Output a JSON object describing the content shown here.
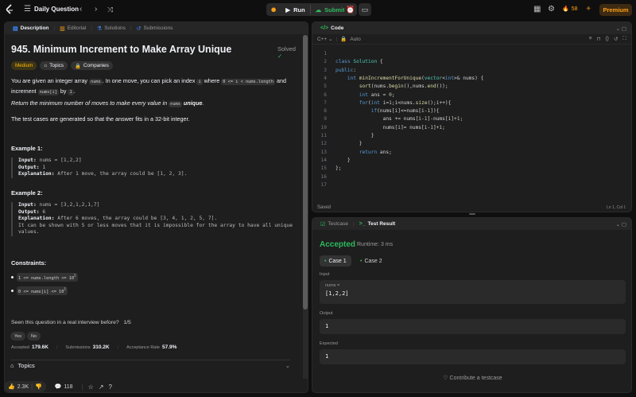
{
  "topbar": {
    "title": "Daily Question",
    "run_label": "Run",
    "submit_label": "Submit",
    "streak_count": "58",
    "premium_label": "Premium"
  },
  "description_panel": {
    "tabs": [
      {
        "label": "Description",
        "icon": "doc-icon"
      },
      {
        "label": "Editorial",
        "icon": "book-icon"
      },
      {
        "label": "Solutions",
        "icon": "flask-icon"
      },
      {
        "label": "Submissions",
        "icon": "history-icon"
      }
    ],
    "title": "945. Minimum Increment to Make Array Unique",
    "status": "Solved",
    "difficulty": "Medium",
    "topics_badge": "Topics",
    "companies_badge": "Companies",
    "para1_a": "You are given an integer array ",
    "para1_code1": "nums",
    "para1_b": ". In one move, you can pick an index ",
    "para1_code2": "i",
    "para1_c": " where ",
    "para1_code3": "0 <= i < nums.length",
    "para1_d": " and",
    "para1_e": "increment ",
    "para1_code4": "nums[i]",
    "para1_f": " by ",
    "para1_code5": "1",
    "para1_g": ".",
    "para2_a": "Return the minimum number of moves to make every value in ",
    "para2_code": "nums",
    "para2_b": "unique",
    "para2_c": ".",
    "para3": "The test cases are generated so that the answer fits in a 32-bit integer.",
    "example1_heading": "Example 1:",
    "example1": {
      "input_label": "Input:",
      "input": "nums = [1,2,2]",
      "output_label": "Output:",
      "output": "1",
      "explanation_label": "Explanation:",
      "explanation": "After 1 move, the array could be [1, 2, 3]."
    },
    "example2_heading": "Example 2:",
    "example2": {
      "input_label": "Input:",
      "input": "nums = [3,2,1,2,1,7]",
      "output_label": "Output:",
      "output": "6",
      "explanation_label": "Explanation:",
      "explanation": "After 6 moves, the array could be [3, 4, 1, 2, 5, 7].",
      "explanation2": "It can be shown with 5 or less moves that it is impossible for the array to have all unique",
      "explanation3": "values."
    },
    "constraints_heading": "Constraints:",
    "constraint1_base": "1 <= nums.length <= 10",
    "constraint1_exp": "5",
    "constraint2_base": "0 <= nums[i] <= 10",
    "constraint2_exp": "5",
    "interview_question": "Seen this question in a real interview before?",
    "interview_page": "1/5",
    "yes_label": "Yes",
    "no_label": "No",
    "accepted_label": "Accepted",
    "accepted_value": "179.6K",
    "submissions_label": "Submissions",
    "submissions_value": "310.2K",
    "rate_label": "Acceptance Rate",
    "rate_value": "57.9%",
    "topics_row_label": "Topics",
    "likes": "2.3K",
    "comments": "118"
  },
  "code_panel": {
    "tab_label": "Code",
    "language": "C++",
    "mode": "Auto",
    "saved": "Saved",
    "cursor": "Ln 1, Col 1",
    "line_numbers": [
      "1",
      "2",
      "3",
      "4",
      "5",
      "6",
      "7",
      "8",
      "9",
      "10",
      "11",
      "12",
      "13",
      "14",
      "15",
      "16",
      "17"
    ],
    "lines": [
      "",
      "class Solution {",
      "public:",
      "    int minIncrementForUnique(vector<int>& nums) {",
      "        sort(nums.begin(),nums.end());",
      "        int ans = 0;",
      "        for(int i=1;i<nums.size();i++){",
      "            if(nums[i]<=nums[i-1]){",
      "                ans += nums[i-1]-nums[i]+1;",
      "                nums[i]= nums[i-1]+1;",
      "            }",
      "        }",
      "        return ans;",
      "    }",
      "};",
      "",
      ""
    ]
  },
  "result_panel": {
    "tabs": [
      {
        "label": "Testcase"
      },
      {
        "label": "Test Result"
      }
    ],
    "status": "Accepted",
    "runtime": "Runtime: 3 ms",
    "case1": "Case 1",
    "case2": "Case 2",
    "input_label": "Input",
    "input_var": "nums =",
    "input_value": "[1,2,2]",
    "output_label": "Output",
    "output_value": "1",
    "expected_label": "Expected",
    "expected_value": "1",
    "contribute": "Contribute a testcase"
  }
}
